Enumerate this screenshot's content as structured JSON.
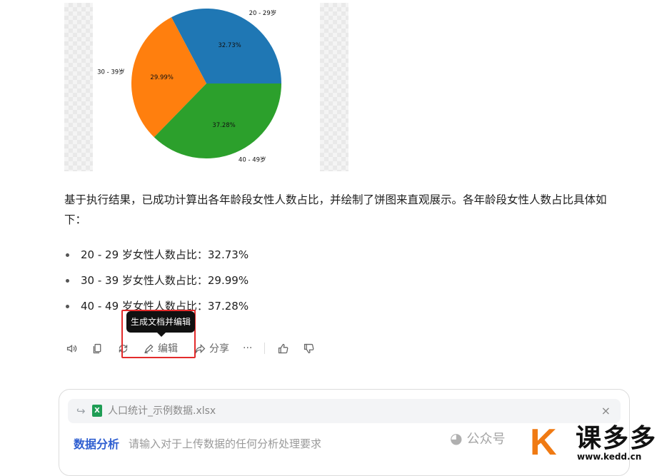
{
  "chart_data": {
    "type": "pie",
    "categories": [
      "20 - 29岁",
      "30 - 39岁",
      "40 - 49岁"
    ],
    "values": [
      32.73,
      29.99,
      37.28
    ],
    "labels": [
      "32.73%",
      "29.99%",
      "37.28%"
    ],
    "colors": [
      "#1f77b4",
      "#ff7f0e",
      "#2ca02c"
    ]
  },
  "message": {
    "summary": "基于执行结果，已成功计算出各年龄段女性人数占比，并绘制了饼图来直观展示。各年龄段女性人数占比具体如下：",
    "bullets": [
      "20 - 29 岁女性人数占比：32.73%",
      "30 - 39 岁女性人数占比：29.99%",
      "40 - 49 岁女性人数占比：37.28%"
    ]
  },
  "actions": {
    "tooltip": "生成文档并编辑",
    "edit_label": "编辑",
    "share_label": "分享",
    "more_label": "···",
    "icons": [
      "speaker-icon",
      "copy-icon",
      "regenerate-icon",
      "edit-icon",
      "share-icon",
      "more-icon",
      "thumbs-up-icon",
      "thumbs-down-icon"
    ]
  },
  "input": {
    "file_name": "人口统计_示例数据.xlsx",
    "file_icon": "X",
    "close_label": "×",
    "mode_label": "数据分析",
    "placeholder": "请输入对于上传数据的任何分析处理要求"
  },
  "watermark": {
    "account": "公众号",
    "brand": "课多多",
    "url": "www.kedd.cn",
    "brand_letter": "K"
  }
}
